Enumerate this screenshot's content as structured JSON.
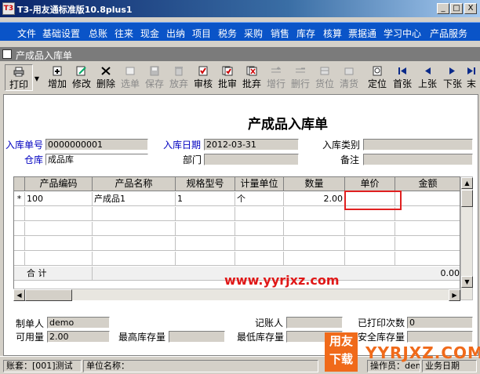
{
  "window": {
    "title": "T3-用友通标准版10.8plus1",
    "icon_text": "T3"
  },
  "window_controls": [
    "_",
    "□",
    "X"
  ],
  "menu": [
    "文件",
    "基础设置",
    "总账",
    "往来",
    "现金",
    "出纳",
    "项目",
    "税务",
    "采购",
    "销售",
    "库存",
    "核算",
    "票据通",
    "学习中心",
    "产品服务"
  ],
  "doc": {
    "title": "产成品入库单"
  },
  "toolbar": [
    {
      "label": "打印",
      "icon": "printer-icon",
      "disabled": false
    },
    {
      "label": "增加",
      "icon": "add-icon",
      "disabled": false
    },
    {
      "label": "修改",
      "icon": "edit-icon",
      "disabled": false
    },
    {
      "label": "删除",
      "icon": "delete-icon",
      "disabled": false
    },
    {
      "label": "选单",
      "icon": "select-icon",
      "disabled": true
    },
    {
      "label": "保存",
      "icon": "save-icon",
      "disabled": true
    },
    {
      "label": "放弃",
      "icon": "discard-icon",
      "disabled": true
    },
    {
      "label": "审核",
      "icon": "audit-icon",
      "disabled": false
    },
    {
      "label": "批审",
      "icon": "batch-audit-icon",
      "disabled": false
    },
    {
      "label": "批弃",
      "icon": "batch-discard-icon",
      "disabled": false
    },
    {
      "label": "增行",
      "icon": "add-row-icon",
      "disabled": true
    },
    {
      "label": "删行",
      "icon": "delete-row-icon",
      "disabled": true
    },
    {
      "label": "货位",
      "icon": "location-icon",
      "disabled": true
    },
    {
      "label": "清货",
      "icon": "clear-icon",
      "disabled": true
    },
    {
      "label": "定位",
      "icon": "locate-icon",
      "disabled": false
    },
    {
      "label": "首张",
      "icon": "first-icon",
      "disabled": false
    },
    {
      "label": "上张",
      "icon": "prev-icon",
      "disabled": false
    },
    {
      "label": "下张",
      "icon": "next-icon",
      "disabled": false
    },
    {
      "label": "末",
      "icon": "last-icon",
      "disabled": false
    }
  ],
  "form": {
    "title": "产成品入库单",
    "receipt_no_label": "入库单号",
    "receipt_no": "0000000001",
    "date_label": "入库日期",
    "date": "2012-03-31",
    "type_label": "入库类别",
    "type": "",
    "warehouse_label": "仓库",
    "warehouse": "成品库",
    "dept_label": "部门",
    "dept": "",
    "remark_label": "备注",
    "remark": ""
  },
  "grid": {
    "columns": [
      "产品编码",
      "产品名称",
      "规格型号",
      "计量单位",
      "数量",
      "单价",
      "金额"
    ],
    "rows": [
      {
        "marker": "*",
        "code": "100",
        "name": "产成品1",
        "spec": "1",
        "unit": "个",
        "qty": "2.00",
        "price": "",
        "amount": ""
      }
    ],
    "total_label": "合 计",
    "total_amount": "0.00"
  },
  "watermark": "www.yyrjxz.com",
  "footer": {
    "maker_label": "制单人",
    "maker": "demo",
    "bookkeeper_label": "记账人",
    "bookkeeper": "",
    "printed_label": "已打印次数",
    "printed": "0",
    "available_label": "可用量",
    "available": "2.00",
    "max_stock_label": "最高库存量",
    "max_stock": "",
    "min_stock_label": "最低库存量",
    "min_stock": "",
    "safety_stock_label": "安全库存量",
    "safety_stock": ""
  },
  "status": {
    "account": "账套：[001]测试",
    "unit": "单位名称：",
    "operator": "操作员：demo(dr",
    "bizdate": "业务日期"
  },
  "logo": {
    "mark": "用友下载",
    "text": "YYRJXZ.COM"
  },
  "colors": {
    "menu_bg": "#0a54c8",
    "highlight": "#e02020",
    "logo": "#f06a1a"
  }
}
